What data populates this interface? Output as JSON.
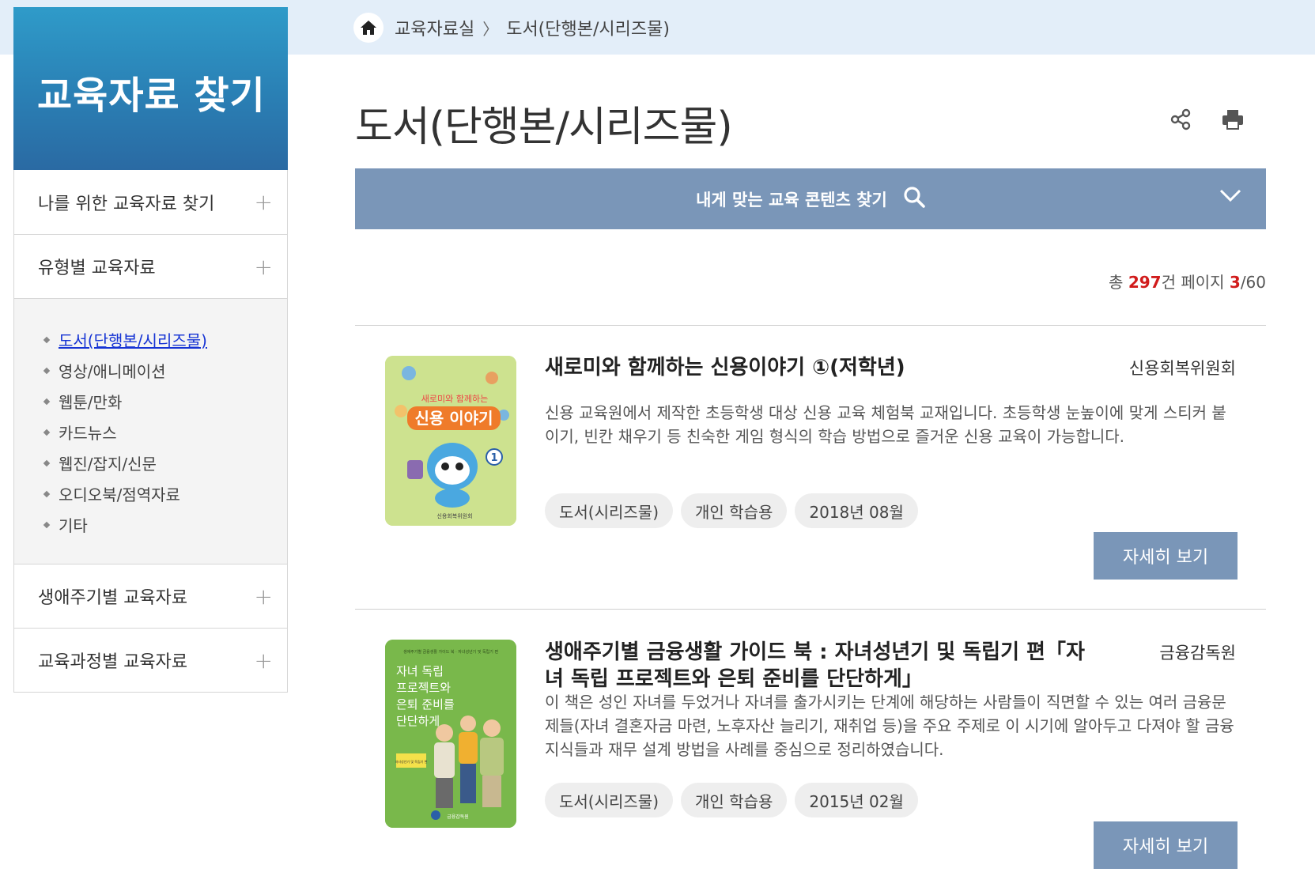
{
  "breadcrumb": {
    "items": [
      "교육자료실",
      "도서(단행본/시리즈물)"
    ],
    "separator": "〉"
  },
  "sidebar": {
    "title": "교육자료 찾기",
    "menu": [
      {
        "label": "나를 위한 교육자료 찾기"
      },
      {
        "label": "유형별 교육자료"
      },
      {
        "label": "생애주기별 교육자료"
      },
      {
        "label": "교육과정별 교육자료"
      }
    ],
    "sub_items": [
      {
        "label": "도서(단행본/시리즈물)",
        "active": true
      },
      {
        "label": "영상/애니메이션"
      },
      {
        "label": "웹툰/만화"
      },
      {
        "label": "카드뉴스"
      },
      {
        "label": "웹진/잡지/신문"
      },
      {
        "label": "오디오북/점역자료"
      },
      {
        "label": "기타"
      }
    ]
  },
  "main": {
    "title": "도서(단행본/시리즈물)",
    "search_label": "내게 맞는 교육 콘텐츠 찾기",
    "count": {
      "prefix": "총 ",
      "total": "297",
      "mid": "건 페이지 ",
      "page": "3",
      "pages": "/60"
    },
    "items": [
      {
        "title": "새로미와 함께하는 신용이야기 ①(저학년)",
        "org": "신용회복위원회",
        "desc": "신용 교육원에서 제작한 초등학생 대상 신용 교육 체험북 교재입니다. 초등학생 눈높이에 맞게 스티커 붙이기, 빈칸 채우기 등 친숙한 게임 형식의 학습 방법으로 즐거운 신용 교육이 가능합니다.",
        "tags": [
          "도서(시리즈물)",
          "개인 학습용",
          "2018년 08월"
        ],
        "button": "자세히 보기",
        "cover_text": {
          "top": "새로미와 함께하는",
          "main": "신용 이야기",
          "num": "1",
          "publisher": "신용회복위원회"
        }
      },
      {
        "title": "생애주기별 금융생활 가이드 북 : 자녀성년기 및 독립기 편「자녀 독립 프로젝트와 은퇴 준비를 단단하게」",
        "org": "금융감독원",
        "desc": "이 책은 성인 자녀를 두었거나 자녀를 출가시키는 단계에 해당하는 사람들이 직면할 수 있는 여러 금융문제들(자녀 결혼자금 마련, 노후자산 늘리기, 재취업 등)을 주요 주제로 이 시기에 알아두고 다져야 할 금융지식들과 재무 설계 방법을 사례를 중심으로 정리하였습니다.",
        "tags": [
          "도서(시리즈물)",
          "개인 학습용",
          "2015년 02월"
        ],
        "button": "자세히 보기",
        "cover_text": {
          "header": "생애주기별 금융생활 가이드 북 · 자녀성년기 및 독립기 편",
          "lines": [
            "자녀 독립",
            "프로젝트와",
            "은퇴 준비를",
            "단단하게"
          ],
          "badge": "자녀성년기 및 독립기 편",
          "publisher": "금융감독원"
        }
      }
    ]
  },
  "colors": {
    "accent": "#7a96b8",
    "sidebar_header": "#2a7fb4",
    "top_band": "#e3eef9",
    "count_highlight": "#d11c1c",
    "active_link": "#1533d4"
  },
  "icons": [
    "home-icon",
    "share-icon",
    "print-icon",
    "search-icon",
    "chevron-down-icon",
    "plus-icon"
  ]
}
